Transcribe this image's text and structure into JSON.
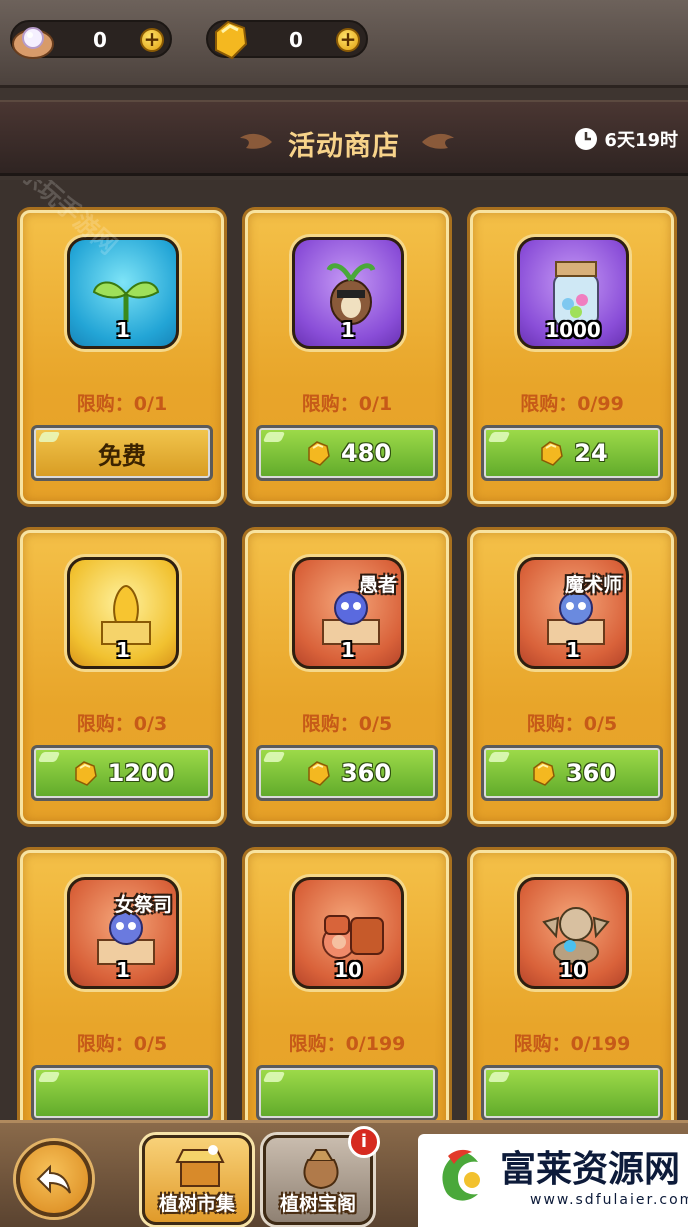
{
  "currency": {
    "pearl": {
      "value": "0",
      "plus": "+"
    },
    "gem": {
      "value": "0",
      "plus": "+"
    }
  },
  "header": {
    "title": "活动商店",
    "timer": "6天19时"
  },
  "cards": [
    {
      "icon": "sprout-icon",
      "qty": "1",
      "tag": "",
      "limit": "限购：0/1",
      "price": "免费",
      "btn": "free",
      "bg": "blue"
    },
    {
      "icon": "mandrake-creature-icon",
      "qty": "1",
      "tag": "",
      "limit": "限购：0/1",
      "price": "480",
      "btn": "green",
      "bg": "purple"
    },
    {
      "icon": "seed-jar-icon",
      "qty": "1000",
      "tag": "",
      "limit": "限购：0/99",
      "price": "24",
      "btn": "green",
      "bg": "purple"
    },
    {
      "icon": "golden-statue-chest-icon",
      "qty": "1",
      "tag": "",
      "limit": "限购：0/3",
      "price": "1200",
      "btn": "green",
      "bg": "gold"
    },
    {
      "icon": "fool-chest-icon",
      "qty": "1",
      "tag": "愚者",
      "limit": "限购：0/5",
      "price": "360",
      "btn": "green",
      "bg": "orange"
    },
    {
      "icon": "magician-chest-icon",
      "qty": "1",
      "tag": "魔术师",
      "limit": "限购：0/5",
      "price": "360",
      "btn": "green",
      "bg": "orange"
    },
    {
      "icon": "priestess-chest-icon",
      "qty": "1",
      "tag": "女祭司",
      "limit": "限购：0/5",
      "price": "",
      "btn": "green",
      "bg": "orange"
    },
    {
      "icon": "meat-icon",
      "qty": "10",
      "tag": "",
      "limit": "限购：0/199",
      "price": "",
      "btn": "green",
      "bg": "orange"
    },
    {
      "icon": "stone-idol-icon",
      "qty": "10",
      "tag": "",
      "limit": "限购：0/199",
      "price": "",
      "btn": "green",
      "bg": "orange"
    }
  ],
  "bottom": {
    "back_icon": "back-arrow-icon",
    "nav1": "植树市集",
    "nav2": "植树宝阁",
    "info": "i"
  },
  "brand": {
    "name": "富莱资源网",
    "url": "www.sdfulaier.com"
  },
  "watermark": "乐玩手游网",
  "colors": {
    "card": "#e8a52a",
    "button_green": "#6fb52e",
    "limit_text": "#c65a18",
    "title": "#f7d38a"
  }
}
